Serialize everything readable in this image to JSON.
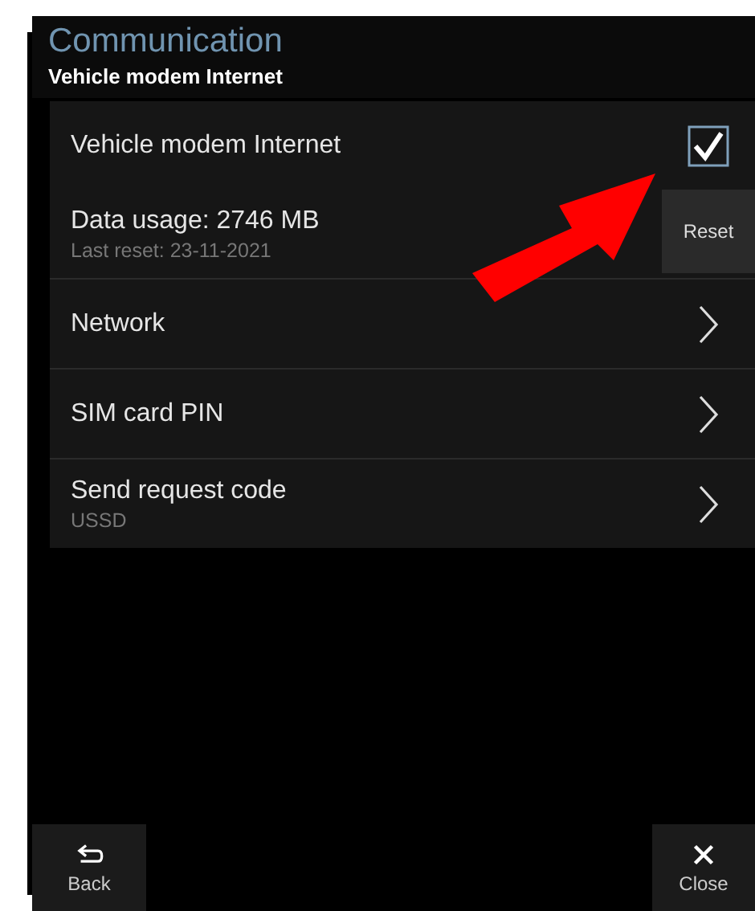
{
  "header": {
    "title": "Communication",
    "subtitle": "Vehicle modem Internet"
  },
  "rows": [
    {
      "kind": "checkbox",
      "label": "Vehicle modem Internet",
      "checked": true
    },
    {
      "kind": "action",
      "label": "Data usage: 2746 MB",
      "sublabel": "Last reset: 23-11-2021",
      "button": "Reset"
    },
    {
      "kind": "link",
      "label": "Network"
    },
    {
      "kind": "link",
      "label": "SIM card PIN"
    },
    {
      "kind": "link",
      "label": "Send request code",
      "sublabel": "USSD"
    }
  ],
  "footer": {
    "back": "Back",
    "close": "Close"
  }
}
